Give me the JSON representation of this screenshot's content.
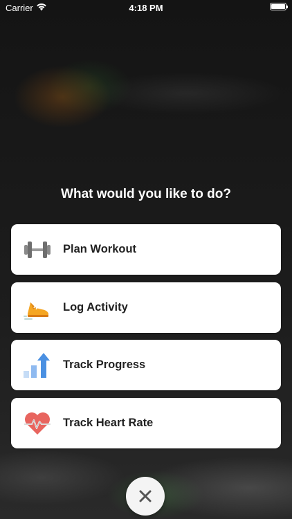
{
  "status_bar": {
    "carrier": "Carrier",
    "time": "4:18 PM",
    "icons": [
      "wifi-icon",
      "battery-icon"
    ]
  },
  "prompt": "What would you like to do?",
  "options": [
    {
      "label": "Plan Workout",
      "icon": "dumbbell-icon"
    },
    {
      "label": "Log Activity",
      "icon": "running-shoe-icon"
    },
    {
      "label": "Track Progress",
      "icon": "progress-bars-icon"
    },
    {
      "label": "Track Heart Rate",
      "icon": "heart-rate-icon"
    }
  ],
  "close_button": {
    "icon": "close-icon"
  },
  "colors": {
    "card_background": "#ffffff",
    "label_text": "#222222",
    "shoe_orange": "#f5a623",
    "progress_blue": "#4a90e2",
    "heart_red": "#e8655f"
  }
}
